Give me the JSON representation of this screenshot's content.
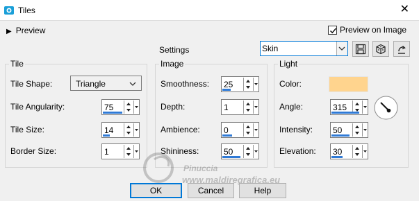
{
  "window": {
    "title": "Tiles",
    "close_glyph": "✕"
  },
  "preview": {
    "toggle_label": "Preview",
    "check_label": "Preview on Image",
    "checked": true
  },
  "settings": {
    "label": "Settings",
    "selected": "Skin"
  },
  "toolbar": {
    "icons": [
      "save-icon",
      "randomize-icon",
      "reset-icon"
    ]
  },
  "tile": {
    "title": "Tile",
    "shape_label": "Tile Shape:",
    "shape_value": "Triangle",
    "angularity_label": "Tile Angularity:",
    "angularity_value": "75",
    "size_label": "Tile Size:",
    "size_value": "14",
    "border_label": "Border Size:",
    "border_value": "1"
  },
  "image": {
    "title": "Image",
    "smoothness_label": "Smoothness:",
    "smoothness_value": "25",
    "depth_label": "Depth:",
    "depth_value": "1",
    "ambience_label": "Ambience:",
    "ambience_value": "0",
    "shininess_label": "Shininess:",
    "shininess_value": "50"
  },
  "light": {
    "title": "Light",
    "color_label": "Color:",
    "color_value": "#ffd48e",
    "angle_label": "Angle:",
    "angle_value": "315",
    "intensity_label": "Intensity:",
    "intensity_value": "50",
    "elevation_label": "Elevation:",
    "elevation_value": "30"
  },
  "buttons": {
    "ok": "OK",
    "cancel": "Cancel",
    "help": "Help"
  },
  "watermark": {
    "line1": "Pinuccia",
    "line2": "www.maldiregrafica.eu"
  },
  "colors": {
    "accent": "#0078d7",
    "slider": "#2f7ad6",
    "light_color": "#ffd48e"
  }
}
